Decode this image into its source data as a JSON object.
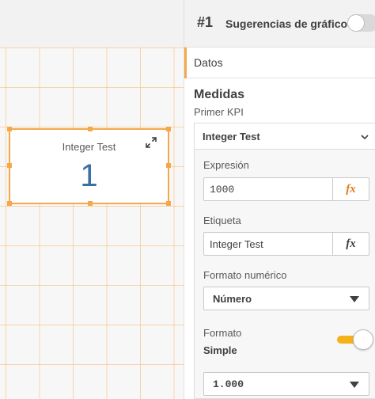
{
  "canvas": {
    "kpi": {
      "title": "Integer Test",
      "value": "1"
    }
  },
  "panel": {
    "object_number": "#1",
    "suggestions_label": "Sugerencias de gráfico",
    "suggestions_enabled": false,
    "tab_label": "Datos",
    "measures_title": "Medidas",
    "kpi_subtitle": "Primer KPI",
    "measure": {
      "name": "Integer Test",
      "expression_label": "Expresión",
      "expression_value": "1000",
      "fx_label": "fx",
      "label_label": "Etiqueta",
      "label_value": "Integer Test",
      "number_format_label": "Formato numérico",
      "number_format_value": "Número",
      "format_label": "Formato",
      "format_mode": "Simple",
      "format_toggle_on": true,
      "format_pattern": "1.000"
    }
  },
  "colors": {
    "accent": "#f5a84a",
    "kpi_value": "#3a6ea5",
    "fx_active": "#e07b1a",
    "toggle_on": "#f5b11a"
  }
}
